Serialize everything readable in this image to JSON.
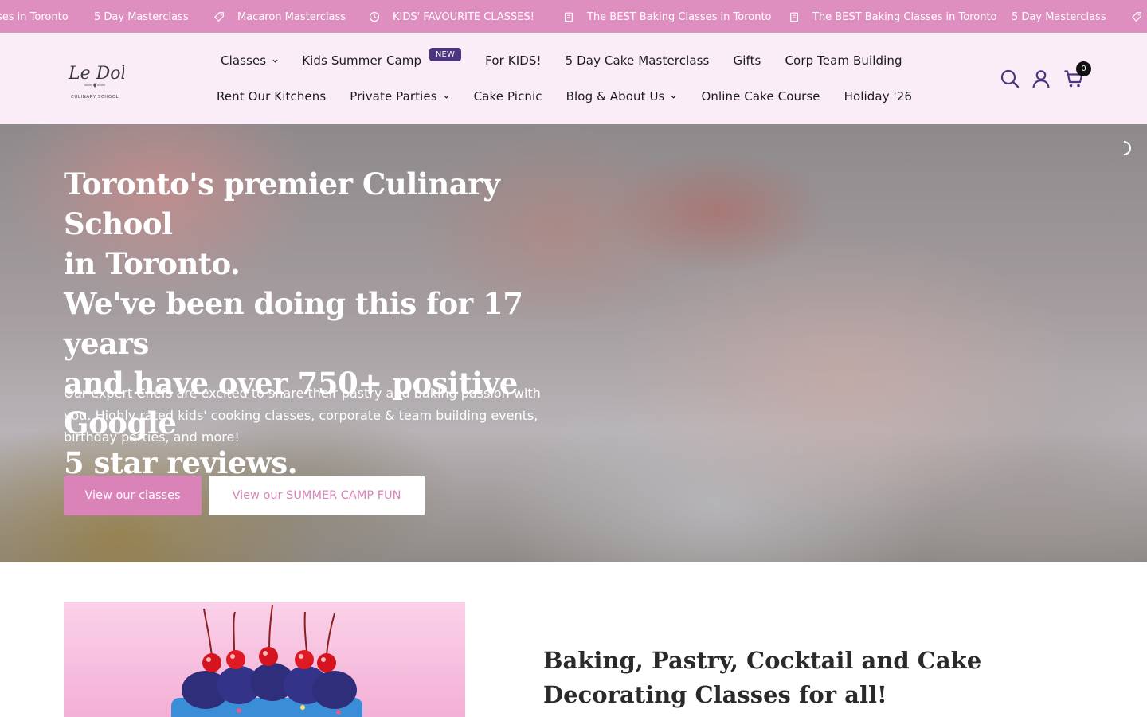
{
  "announcement": {
    "items": [
      {
        "text": "ses in Toronto",
        "icon": "none"
      },
      {
        "text": "5 Day Masterclass",
        "icon": "none"
      },
      {
        "text": "Macaron Masterclass",
        "icon": "tag-icon"
      },
      {
        "text": "KIDS' FAVOURITE CLASSES!",
        "icon": "clock-icon"
      },
      {
        "text": "The BEST Baking Classes in Toronto",
        "icon": "clipboard-icon"
      },
      {
        "text": "The BEST Baking Classes in Toronto",
        "icon": "clipboard-icon"
      },
      {
        "text": "5 Day Masterclass",
        "icon": "none"
      }
    ]
  },
  "header": {
    "logo": {
      "script": "Le Dolci",
      "subtitle": "CULINARY SCHOOL"
    },
    "nav_row1": [
      {
        "label": "Classes",
        "has_dropdown": true
      },
      {
        "label": "Kids Summer Camp",
        "badge": "NEW"
      },
      {
        "label": "For KIDS!"
      },
      {
        "label": "5 Day Cake Masterclass"
      },
      {
        "label": "Gifts"
      },
      {
        "label": "Corp Team Building"
      }
    ],
    "nav_row2": [
      {
        "label": "Rent Our Kitchens"
      },
      {
        "label": "Private Parties",
        "has_dropdown": true
      },
      {
        "label": "Cake Picnic"
      },
      {
        "label": "Blog & About Us",
        "has_dropdown": true
      },
      {
        "label": "Online Cake Course"
      },
      {
        "label": "Holiday '26"
      }
    ],
    "cart_count": "0"
  },
  "hero": {
    "title_lines": [
      "Toronto's premier Culinary School",
      "in Toronto.",
      "We've been doing this for 17 years",
      "and have over 750+ positive Google",
      "5 star reviews."
    ],
    "body": "Our expert Chefs are excited to share their pastry and baking passion with you. Highly rated kids' cooking classes, corporate & team building events, birthday parties, and more!",
    "primary_button": "View our classes",
    "secondary_button": "View our SUMMER CAMP FUN"
  },
  "section": {
    "title": "Baking, Pastry, Cocktail and Cake Decorating Classes for all!"
  },
  "colors": {
    "announcement_bg": "#de8fc0",
    "header_bg": "#fbedf7",
    "accent": "#d983b9",
    "badge_bg": "#4c357e",
    "icon_color": "#4c357e"
  }
}
